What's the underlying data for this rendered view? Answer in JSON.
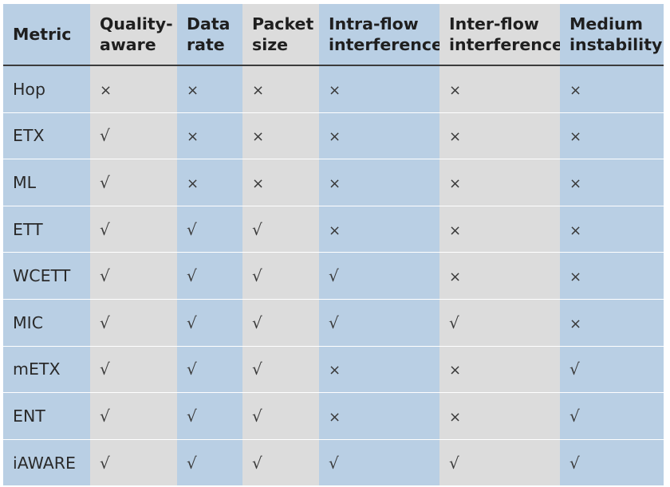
{
  "table": {
    "headers": [
      {
        "lines": [
          "Metric"
        ]
      },
      {
        "lines": [
          "Quality-",
          "aware"
        ]
      },
      {
        "lines": [
          "Data",
          "rate"
        ]
      },
      {
        "lines": [
          "Packet",
          "size"
        ]
      },
      {
        "lines": [
          "Intra-flow",
          "interference"
        ]
      },
      {
        "lines": [
          "Inter-flow",
          "interference"
        ]
      },
      {
        "lines": [
          "Medium",
          "instability"
        ]
      }
    ],
    "rows": [
      {
        "metric": "Hop",
        "cells": [
          "×",
          "×",
          "×",
          "×",
          "×",
          "×"
        ]
      },
      {
        "metric": "ETX",
        "cells": [
          "√",
          "×",
          "×",
          "×",
          "×",
          "×"
        ]
      },
      {
        "metric": "ML",
        "cells": [
          "√",
          "×",
          "×",
          "×",
          "×",
          "×"
        ]
      },
      {
        "metric": "ETT",
        "cells": [
          "√",
          "√",
          "√",
          "×",
          "×",
          "×"
        ]
      },
      {
        "metric": "WCETT",
        "cells": [
          "√",
          "√",
          "√",
          "√",
          "×",
          "×"
        ]
      },
      {
        "metric": "MIC",
        "cells": [
          "√",
          "√",
          "√",
          "√",
          "√",
          "×"
        ]
      },
      {
        "metric": "mETX",
        "cells": [
          "√",
          "√",
          "√",
          "×",
          "×",
          "√"
        ]
      },
      {
        "metric": "ENT",
        "cells": [
          "√",
          "√",
          "√",
          "×",
          "×",
          "√"
        ]
      },
      {
        "metric": "iAWARE",
        "cells": [
          "√",
          "√",
          "√",
          "√",
          "√",
          "√"
        ]
      }
    ]
  },
  "colors": {
    "blue_column": "#b9cfe4",
    "gray_column": "#dcdcdc",
    "header_rule": "#3c3c3c"
  }
}
